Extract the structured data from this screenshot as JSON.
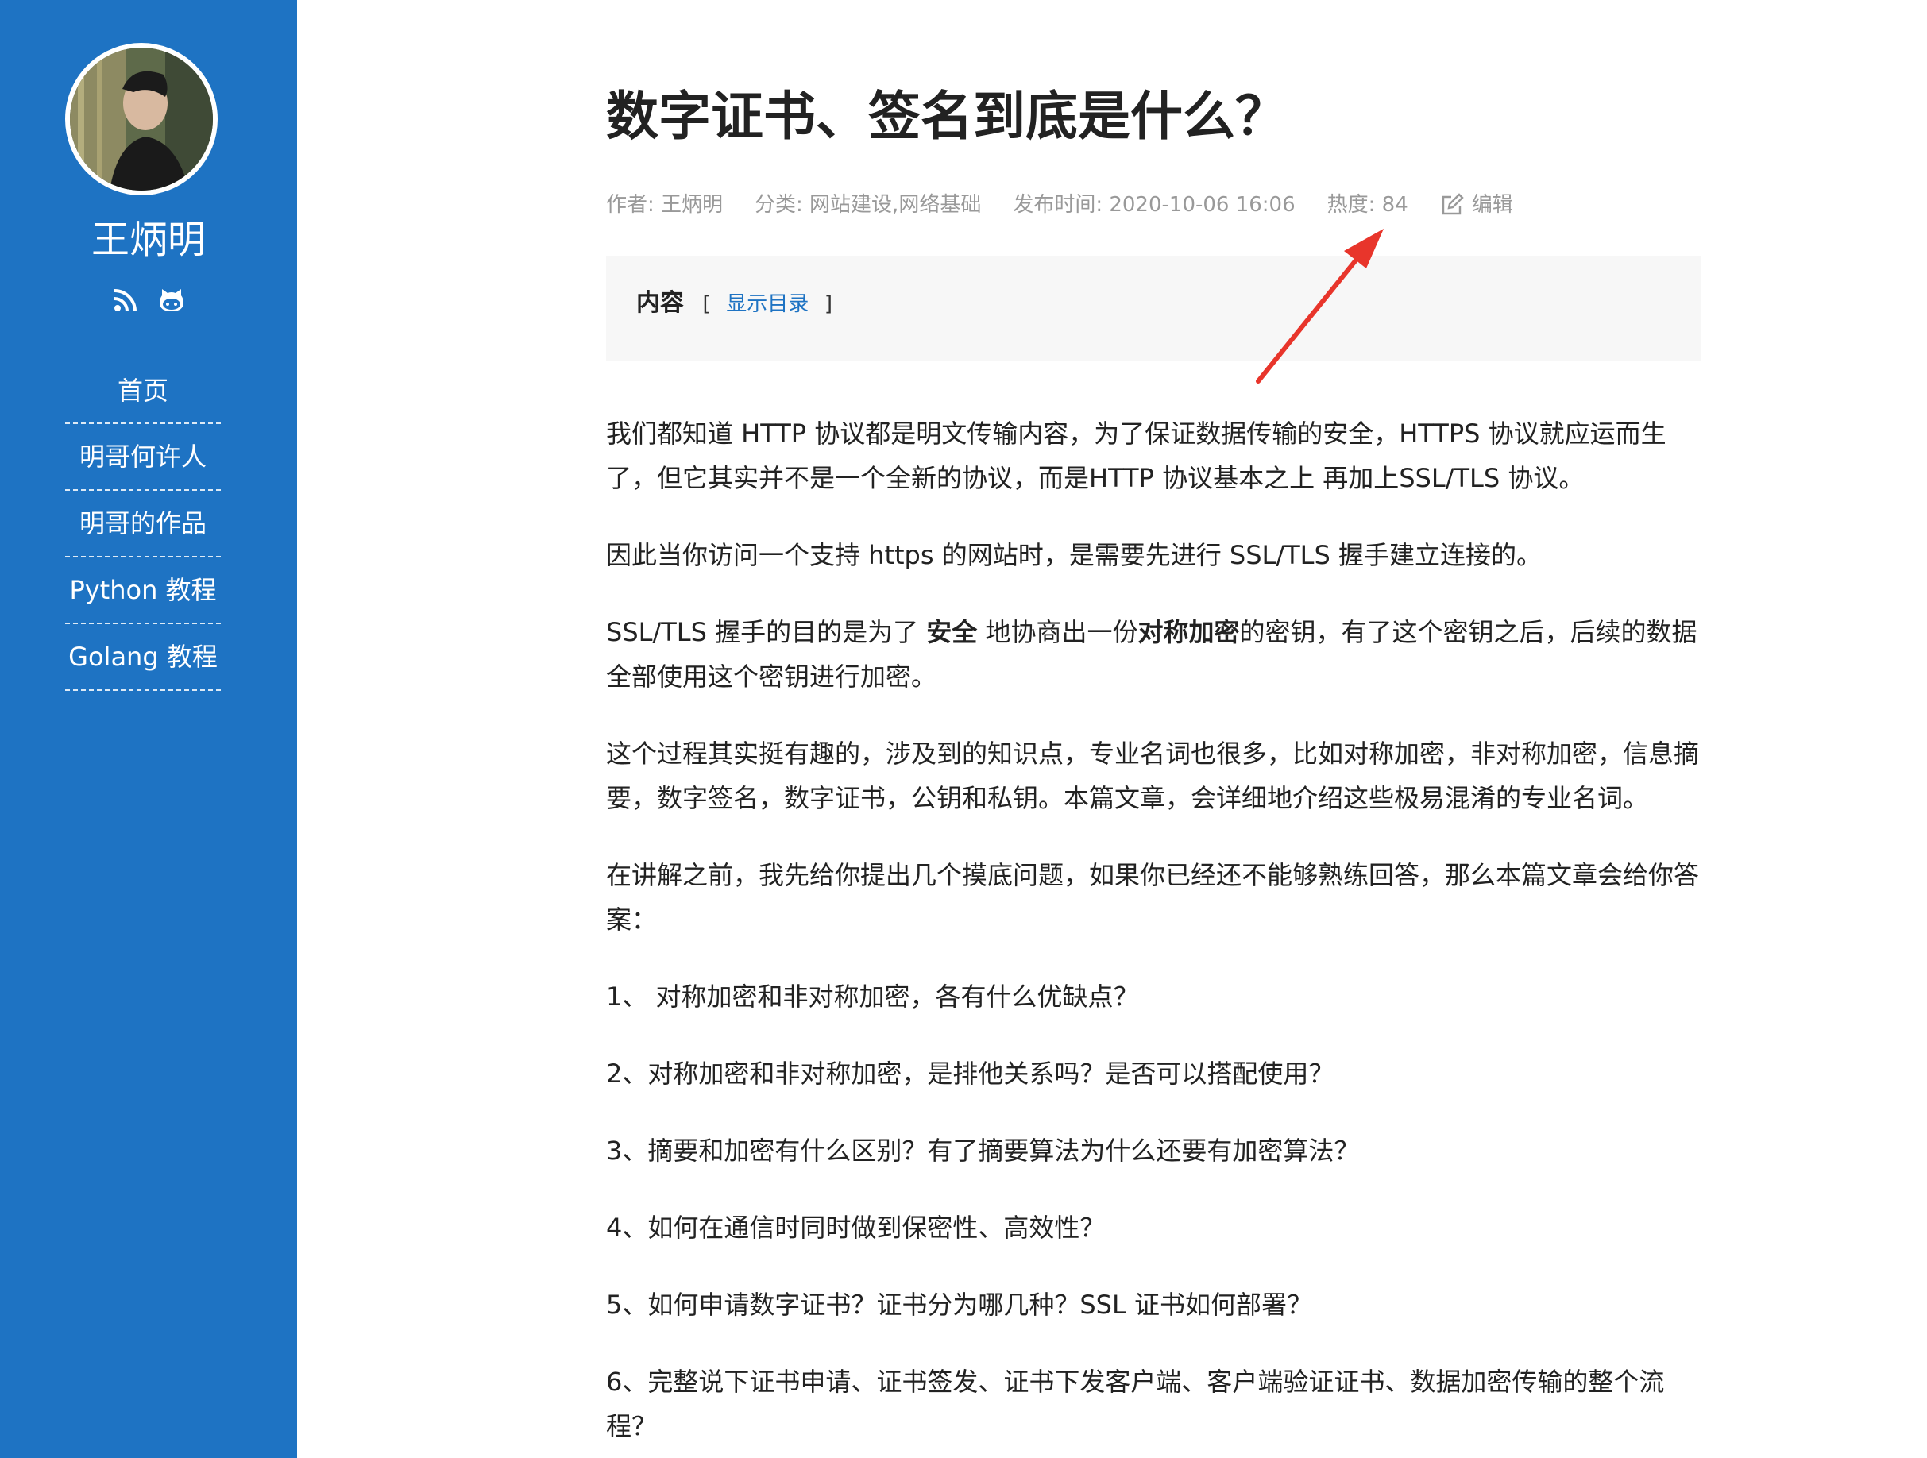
{
  "sidebar": {
    "author_name": "王炳明",
    "social_icons": [
      "rss-icon",
      "github-icon"
    ],
    "nav": [
      "首页",
      "明哥何许人",
      "明哥的作品",
      "Python 教程",
      "Golang 教程"
    ],
    "bg_color": "#1e73c3"
  },
  "article": {
    "title": "数字证书、签名到底是什么？",
    "meta": {
      "author": "作者: 王炳明",
      "category": "分类: 网站建设,网络基础",
      "published": "发布时间: 2020-10-06 16:06",
      "heat": "热度: 84",
      "edit": "编辑"
    },
    "toc": {
      "title": "内容",
      "open_bracket": "[",
      "link": "显示目录",
      "close_bracket": "]"
    },
    "paragraphs": {
      "p1": "我们都知道 HTTP 协议都是明文传输内容，为了保证数据传输的安全，HTTPS 协议就应运而生了，但它其实并不是一个全新的协议，而是HTTP 协议基本之上 再加上SSL/TLS 协议。",
      "p2": "因此当你访问一个支持 https 的网站时，是需要先进行 SSL/TLS 握手建立连接的。",
      "p3": {
        "a": "SSL/TLS 握手的目的是为了 ",
        "b1": "安全",
        "c": " 地协商出一份",
        "b2": "对称加密",
        "d": "的密钥，有了这个密钥之后，后续的数据全部使用这个密钥进行加密。"
      },
      "p4": "这个过程其实挺有趣的，涉及到的知识点，专业名词也很多，比如对称加密，非对称加密，信息摘要，数字签名，数字证书，公钥和私钥。本篇文章，会详细地介绍这些极易混淆的专业名词。",
      "p5": "在讲解之前，我先给你提出几个摸底问题，如果你已经还不能够熟练回答，那么本篇文章会给你答案：",
      "q1": "1、 对称加密和非对称加密，各有什么优缺点？",
      "q2": "2、对称加密和非对称加密，是排他关系吗？是否可以搭配使用？",
      "q3": "3、摘要和加密有什么区别？有了摘要算法为什么还要有加密算法？",
      "q4": "4、如何在通信时同时做到保密性、高效性？",
      "q5": "5、如何申请数字证书？证书分为哪几种？SSL 证书如何部署？",
      "q6": "6、完整说下证书申请、证书签发、证书下发客户端、客户端验证证书、数据加密传输的整个流程？"
    }
  },
  "annotation": {
    "arrow_color": "#e8352b"
  }
}
